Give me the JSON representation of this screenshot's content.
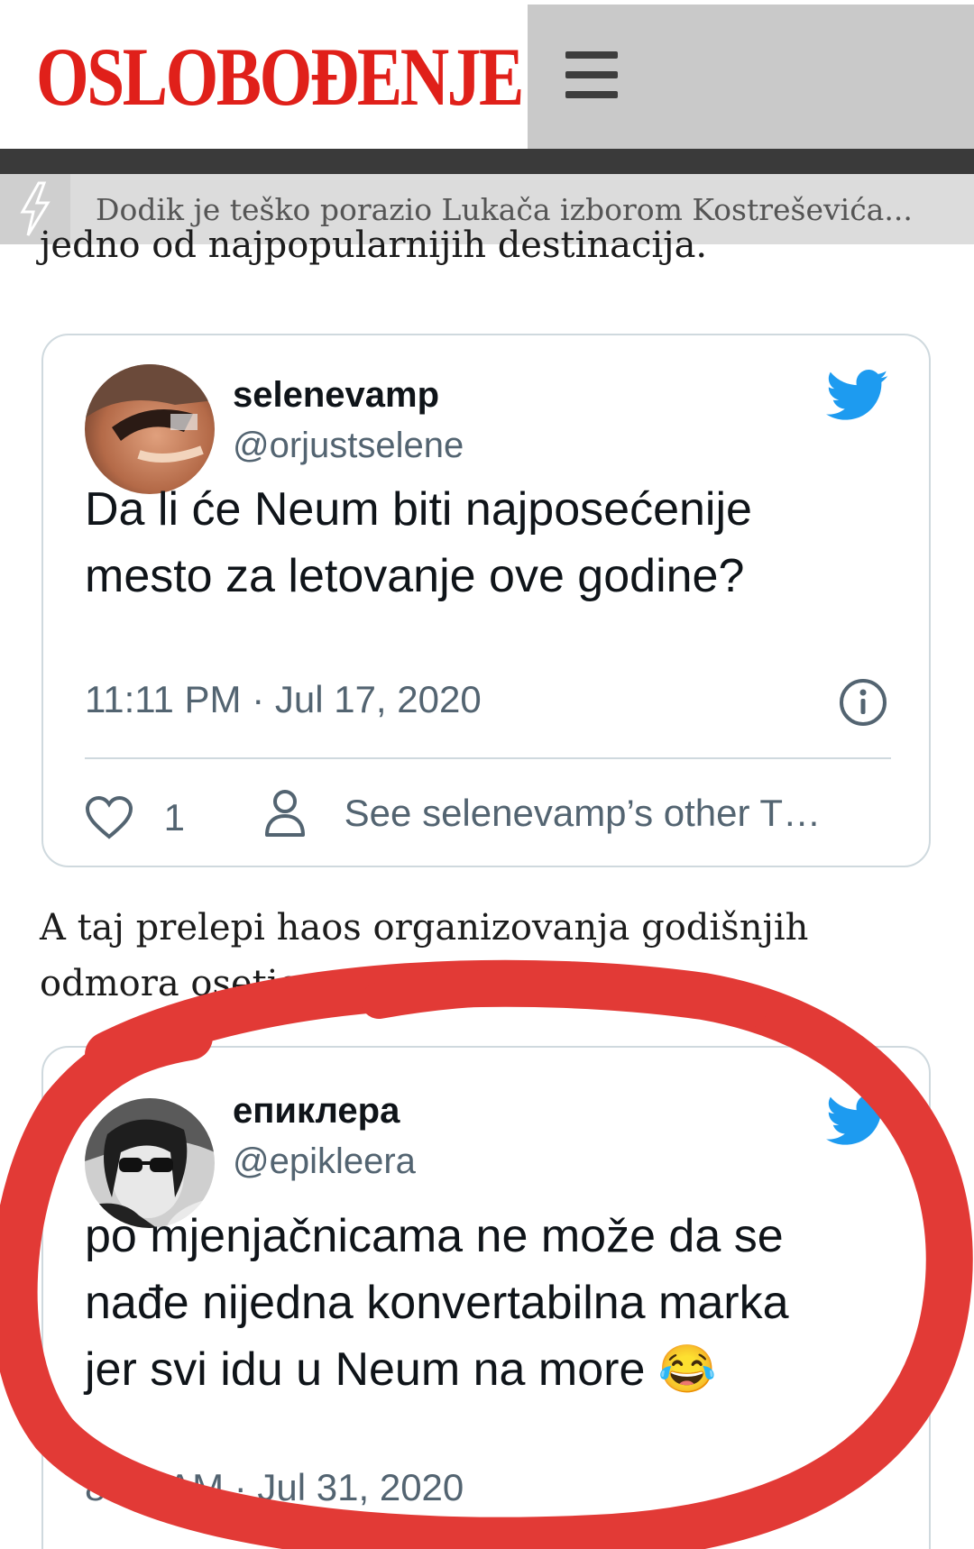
{
  "header": {
    "logo_text": "OSLOBOĐENJE",
    "menu_icon": "hamburger-menu-icon",
    "brand_color": "#e0201a"
  },
  "ticker": {
    "icon": "lightning-icon",
    "headline": "Dodik je teško porazio Lukača izborom Kostreševića..."
  },
  "article": {
    "paragraph_top": "jedno od najpopularnijih destinacija.",
    "paragraph_middle_line1": "A taj prelepi haos organizovanja godišnjih",
    "paragraph_middle_line2": "odmora osetio se na svakom koraku."
  },
  "tweets": [
    {
      "name": "selenevamp",
      "handle": "@orjustselene",
      "text_line1": "Da li će Neum biti najposećenije",
      "text_line2": "mesto za letovanje ove godine?",
      "time": "11:11 PM · Jul 17, 2020",
      "likes": "1",
      "other_tweets_link": "See selenevamp’s other T…",
      "icons": [
        "twitter-bird-icon",
        "info-icon",
        "heart-icon",
        "person-icon"
      ]
    },
    {
      "name": "епиклера",
      "handle": "@epikleera",
      "text_line1": "po mjenjačnicama ne može da se",
      "text_line2": "nađe nijedna konvertabilna marka",
      "text_line3": "jer svi idu u Neum na more 😂",
      "time": "8:16 AM · Jul 31, 2020",
      "icons": [
        "twitter-bird-icon"
      ]
    }
  ],
  "colors": {
    "twitter_blue": "#1d9bf0",
    "annotation_red": "#e23a36"
  }
}
